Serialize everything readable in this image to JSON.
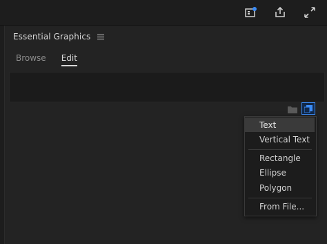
{
  "toolbar": {
    "icons": [
      "quick-export-notification-icon",
      "share-icon",
      "fullscreen-icon"
    ],
    "accent": "#3b8bf5"
  },
  "panel": {
    "title": "Essential Graphics",
    "menu_icon": "hamburger-icon"
  },
  "tabs": [
    {
      "label": "Browse",
      "active": false
    },
    {
      "label": "Edit",
      "active": true
    }
  ],
  "layer_actions": {
    "folder_icon": "folder-icon",
    "new_layer_icon": "new-layer-icon"
  },
  "new_layer_menu": {
    "items": [
      {
        "label": "Text",
        "highlighted": true
      },
      {
        "label": "Vertical Text",
        "highlighted": false
      },
      {
        "label": "Rectangle",
        "highlighted": false
      },
      {
        "label": "Ellipse",
        "highlighted": false
      },
      {
        "label": "Polygon",
        "highlighted": false
      },
      {
        "label": "From File...",
        "highlighted": false
      }
    ]
  }
}
